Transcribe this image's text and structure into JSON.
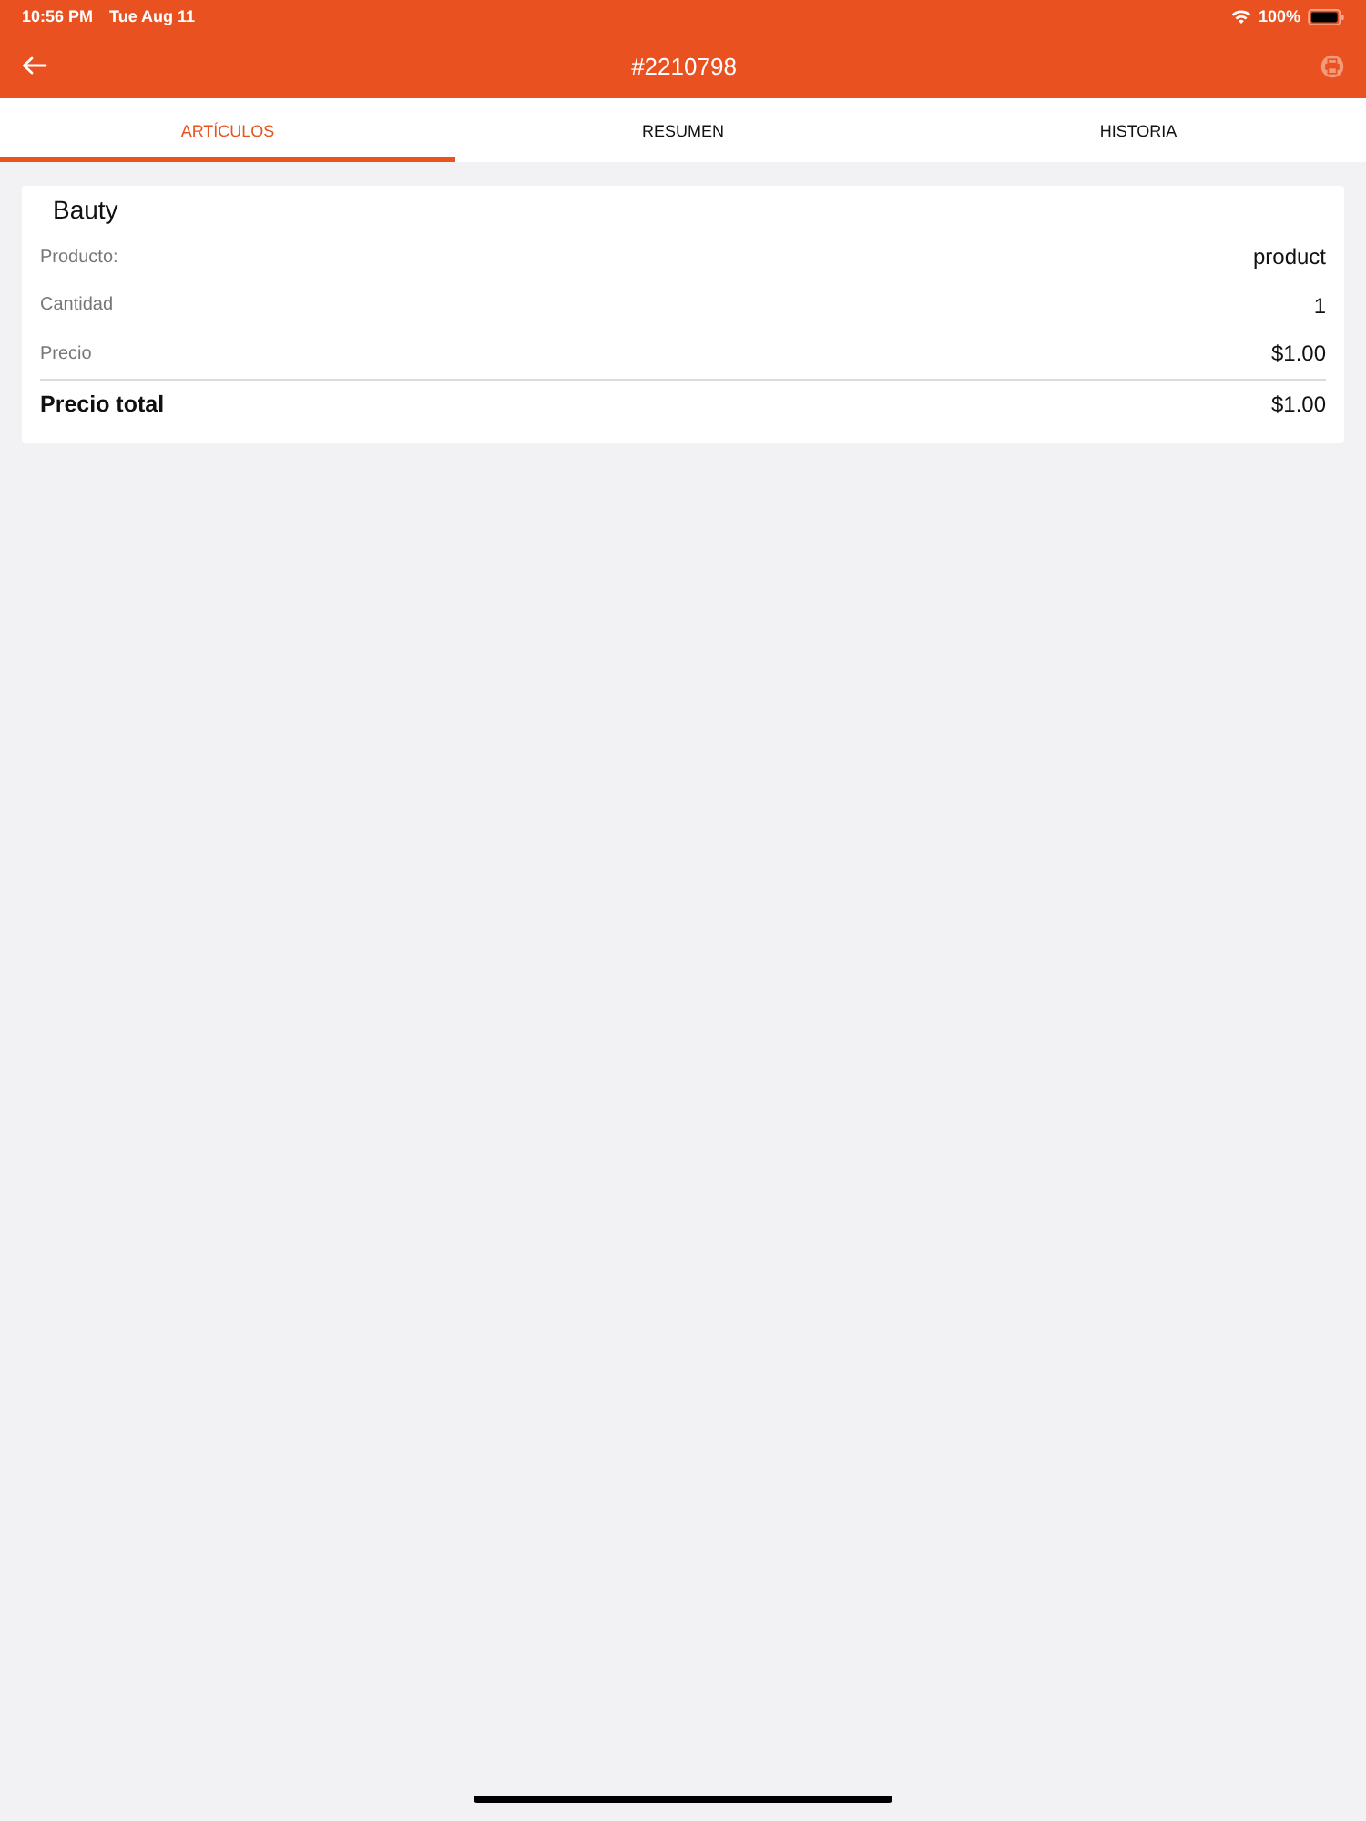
{
  "status_bar": {
    "time": "10:56 PM",
    "date": "Tue Aug 11",
    "battery": "100%"
  },
  "header": {
    "title": "#2210798"
  },
  "tabs": [
    {
      "label": "ARTÍCULOS",
      "selected": true
    },
    {
      "label": "RESUMEN",
      "selected": false
    },
    {
      "label": "HISTORIA",
      "selected": false
    }
  ],
  "item_card": {
    "title": "Bauty",
    "rows": [
      {
        "kind": "detail",
        "label": "Producto:",
        "value": "product"
      },
      {
        "kind": "detail",
        "label": "Cantidad",
        "value": "1"
      },
      {
        "kind": "detail",
        "label": "Precio",
        "value": "$1.00"
      },
      {
        "kind": "total",
        "label": "Precio total",
        "value": "$1.00"
      }
    ]
  }
}
